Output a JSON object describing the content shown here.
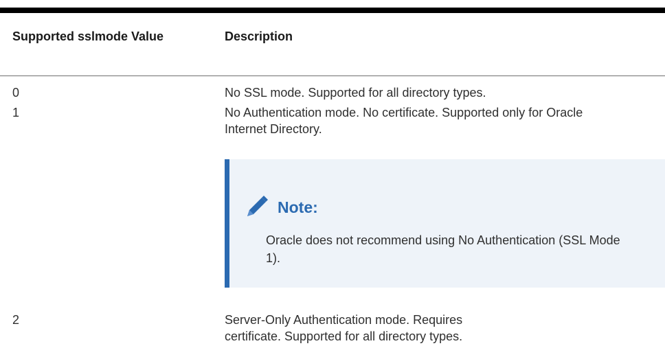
{
  "table": {
    "headers": [
      "Supported sslmode Value",
      "Description"
    ],
    "rows": [
      {
        "value": "0",
        "description": "No SSL mode. Supported for all directory types."
      },
      {
        "value": "1",
        "description": "No Authentication mode. No certificate. Supported only for Oracle Internet Directory."
      },
      {
        "value": "2",
        "description": "Server-Only Authentication mode. Requires certificate. Supported for all directory types."
      }
    ]
  },
  "note": {
    "icon": "pencil-icon",
    "title": "Note:",
    "text": "Oracle does not recommend using No Authentication (SSL Mode 1).",
    "accent_color": "#2b6ab1",
    "background_color": "#eef3f9"
  }
}
